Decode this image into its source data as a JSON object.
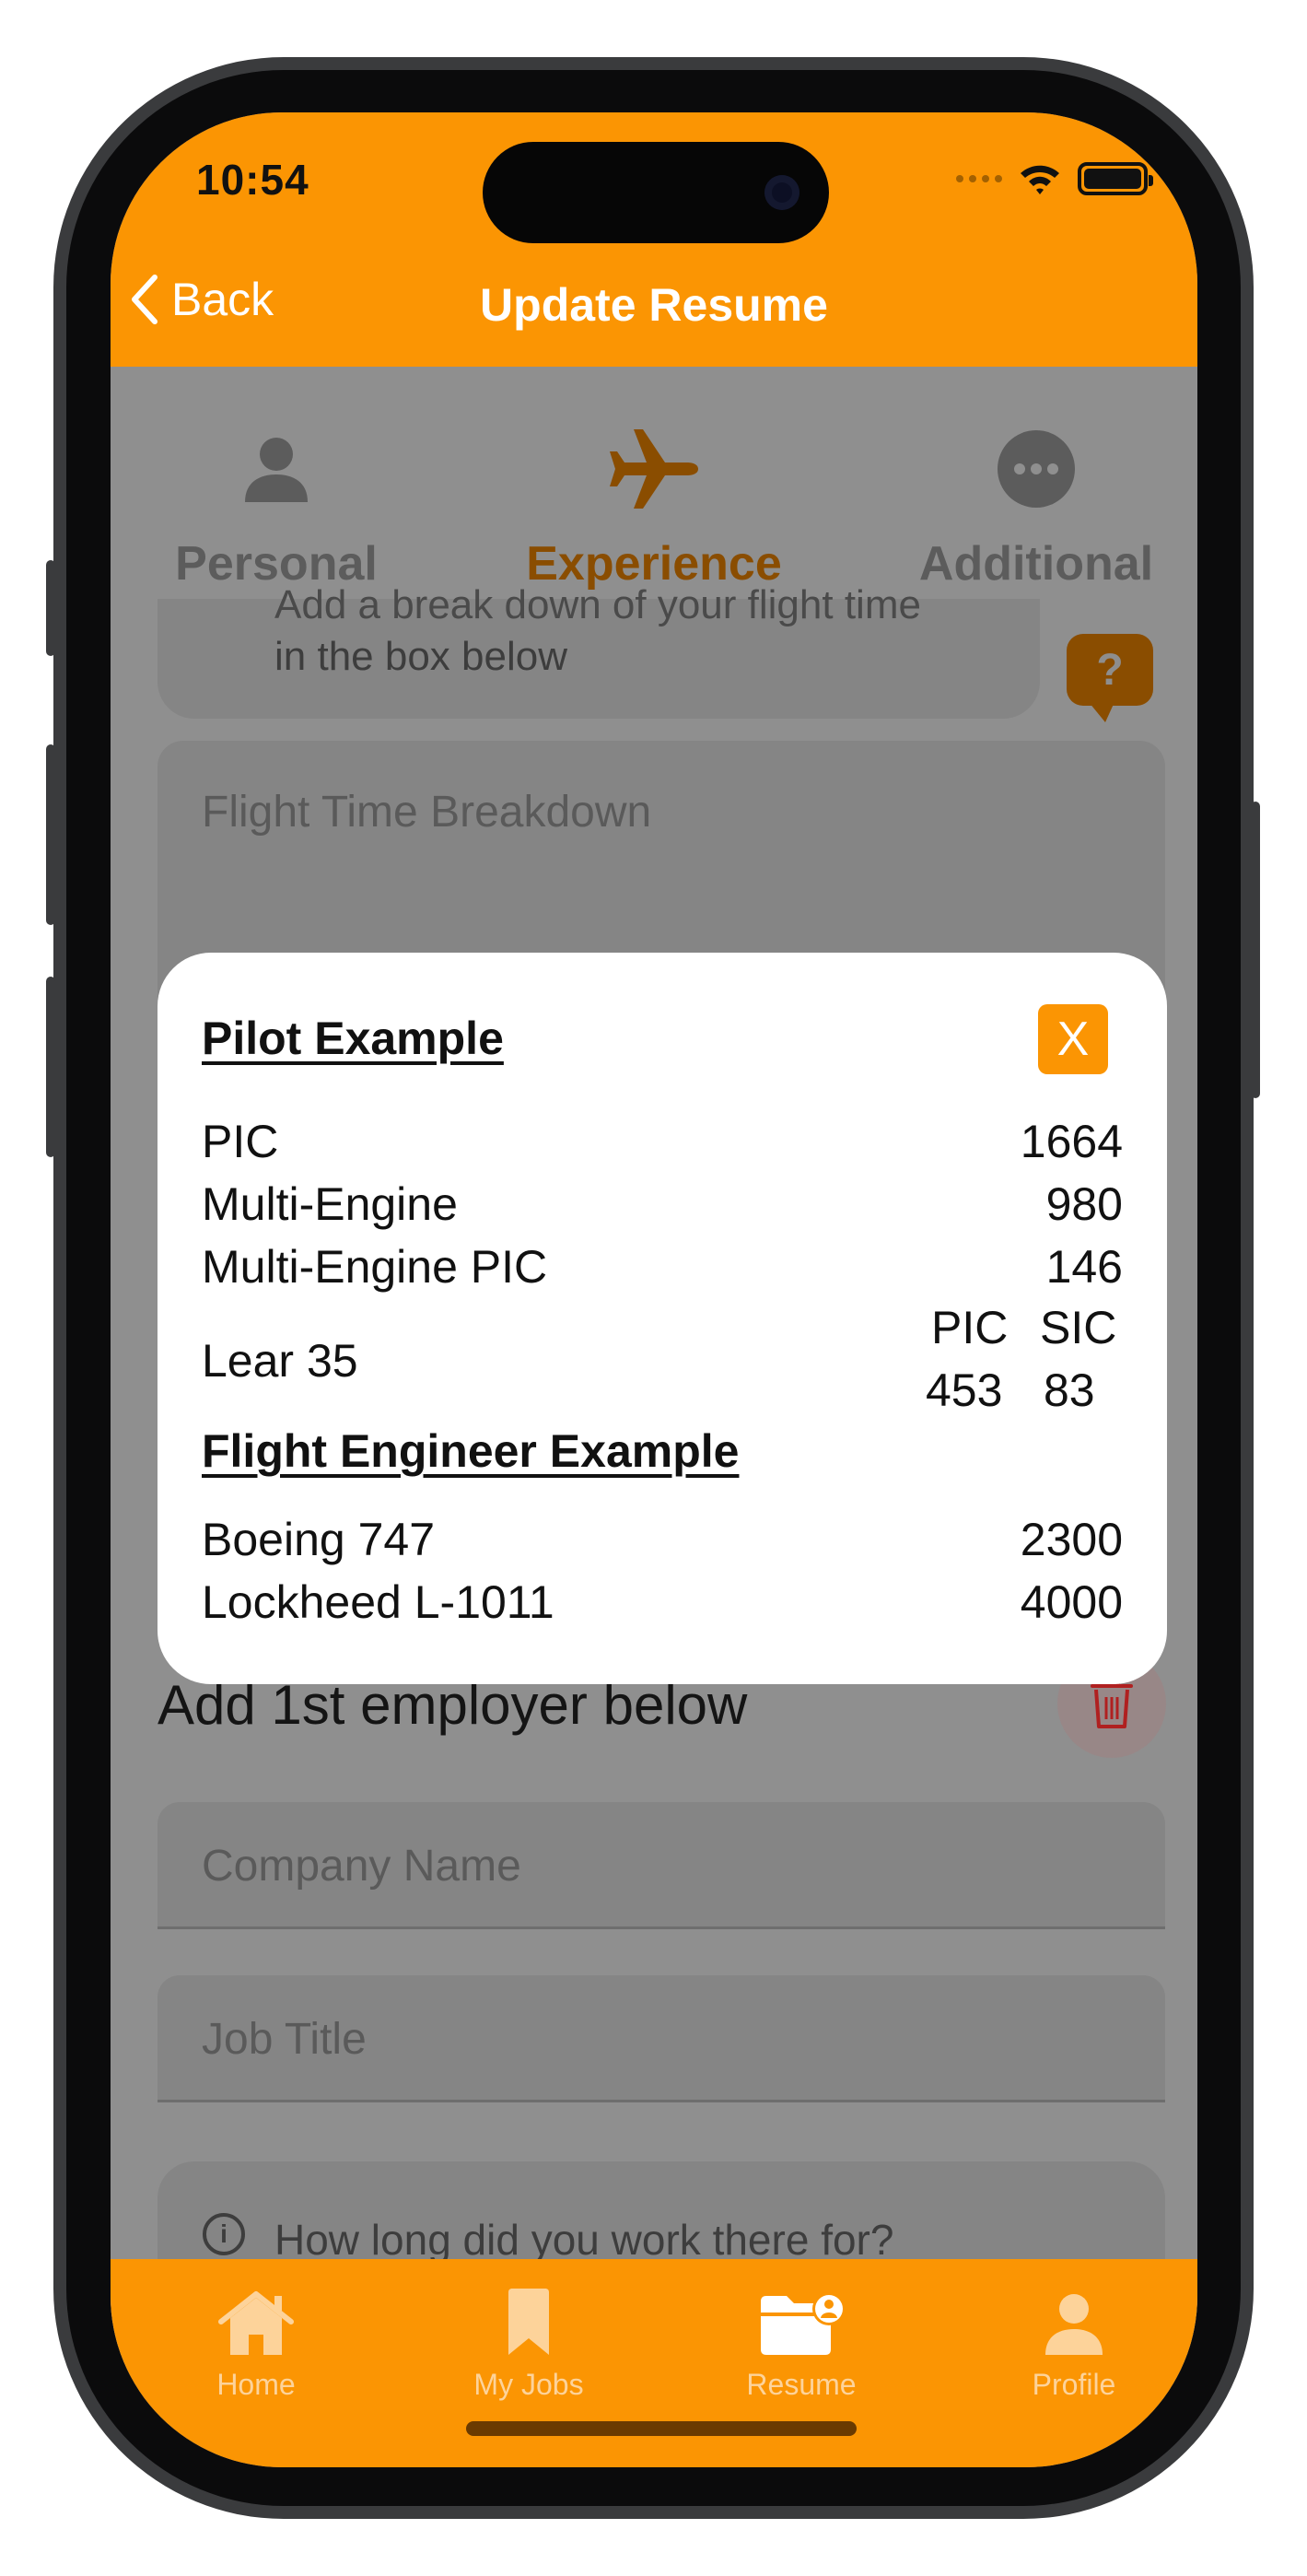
{
  "status_bar": {
    "time": "10:54"
  },
  "nav": {
    "back_label": "Back",
    "title": "Update Resume"
  },
  "steps": [
    {
      "label": "Personal",
      "icon": "person-icon",
      "active": false
    },
    {
      "label": "Experience",
      "icon": "airplane-icon",
      "active": true
    },
    {
      "label": "Additional",
      "icon": "ellipsis-circle-icon",
      "active": false
    }
  ],
  "hint": {
    "line1": "Add a break down of your flight time",
    "line2": "in the box below",
    "help_label": "?"
  },
  "flight_time_placeholder": "Flight Time Breakdown",
  "employer": {
    "heading": "Add 1st employer below",
    "company_placeholder": "Company Name",
    "job_title_placeholder": "Job Title",
    "duration_question": "How long did you work there for?"
  },
  "modal": {
    "close_label": "X",
    "pilot_heading": "Pilot Example",
    "pilot_rows": [
      {
        "label": "PIC",
        "value": "1664"
      },
      {
        "label": "Multi-Engine",
        "value": "980"
      },
      {
        "label": "Multi-Engine PIC",
        "value": "146"
      }
    ],
    "lear": {
      "label": "Lear 35",
      "col1_header": "PIC",
      "col2_header": "SIC",
      "col1_value": "453",
      "col2_value": "83"
    },
    "engineer_heading": "Flight Engineer Example",
    "engineer_rows": [
      {
        "label": "Boeing 747",
        "value": "2300"
      },
      {
        "label": "Lockheed L-1011",
        "value": "4000"
      }
    ]
  },
  "tabbar": [
    {
      "label": "Home",
      "icon": "house-icon",
      "active": false
    },
    {
      "label": "My Jobs",
      "icon": "bookmark-icon",
      "active": false
    },
    {
      "label": "Resume",
      "icon": "folder-person-icon",
      "active": true
    },
    {
      "label": "Profile",
      "icon": "person-icon",
      "active": false
    }
  ],
  "colors": {
    "accent": "#fb9503",
    "overlay": "#8f8f8f",
    "modal_bg": "#ffffff",
    "active_step": "#8a4d00"
  }
}
